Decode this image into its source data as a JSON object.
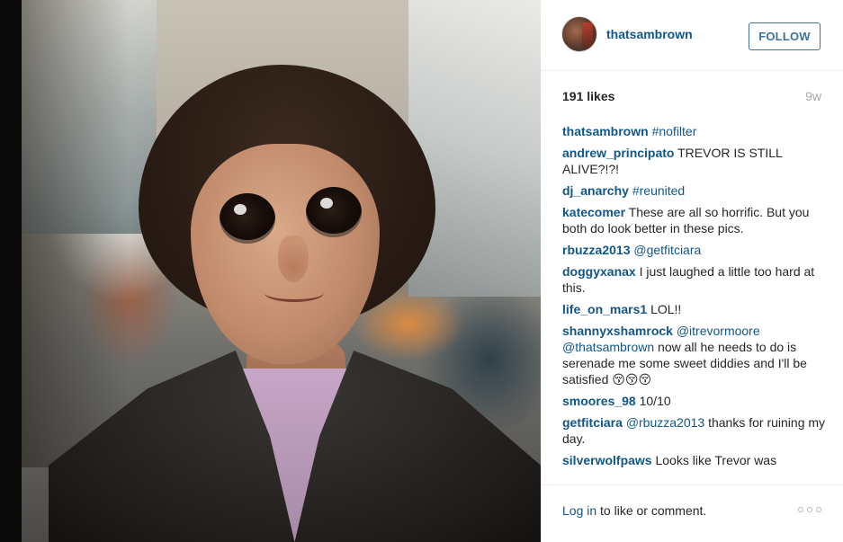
{
  "header": {
    "username": "thatsambrown",
    "follow_label": "FOLLOW"
  },
  "meta": {
    "likes": "191 likes",
    "age": "9w"
  },
  "comments": [
    {
      "user": "thatsambrown",
      "segments": [
        {
          "text": "#nofilter",
          "type": "tag"
        }
      ]
    },
    {
      "user": "andrew_principato",
      "segments": [
        {
          "text": "TREVOR IS STILL ALIVE?!?!",
          "type": "text"
        }
      ]
    },
    {
      "user": "dj_anarchy",
      "segments": [
        {
          "text": "#reunited",
          "type": "tag"
        }
      ]
    },
    {
      "user": "katecomer",
      "segments": [
        {
          "text": "These are all so horrific. But you both do look better in these pics.",
          "type": "text"
        }
      ]
    },
    {
      "user": "rbuzza2013",
      "segments": [
        {
          "text": "@getfitciara",
          "type": "tag"
        }
      ]
    },
    {
      "user": "doggyxanax",
      "segments": [
        {
          "text": "I just laughed a little too hard at this.",
          "type": "text"
        }
      ]
    },
    {
      "user": "life_on_mars1",
      "segments": [
        {
          "text": "LOL!!",
          "type": "text"
        }
      ]
    },
    {
      "user": "shannyxshamrock",
      "segments": [
        {
          "text": "@itrevormoore",
          "type": "tag"
        },
        {
          "text": " ",
          "type": "text"
        },
        {
          "text": "@thatsambrown",
          "type": "tag"
        },
        {
          "text": " now all he needs to do is serenade me some sweet diddies and I'll be satisfied 😚😚😚",
          "type": "text"
        }
      ]
    },
    {
      "user": "smoores_98",
      "segments": [
        {
          "text": "10/10",
          "type": "text"
        }
      ]
    },
    {
      "user": "getfitciara",
      "segments": [
        {
          "text": "@rbuzza2013",
          "type": "tag"
        },
        {
          "text": " thanks for ruining my day.",
          "type": "text"
        }
      ]
    },
    {
      "user": "silverwolfpaws",
      "segments": [
        {
          "text": "Looks like Trevor was",
          "type": "text"
        }
      ]
    }
  ],
  "footer": {
    "login_link": "Log in",
    "login_rest": " to like or comment.",
    "more_icon": "more-options-icon"
  },
  "colors": {
    "link": "#125688",
    "follow_border": "#3f729b",
    "muted": "#a5a7aa",
    "text": "#262626"
  }
}
